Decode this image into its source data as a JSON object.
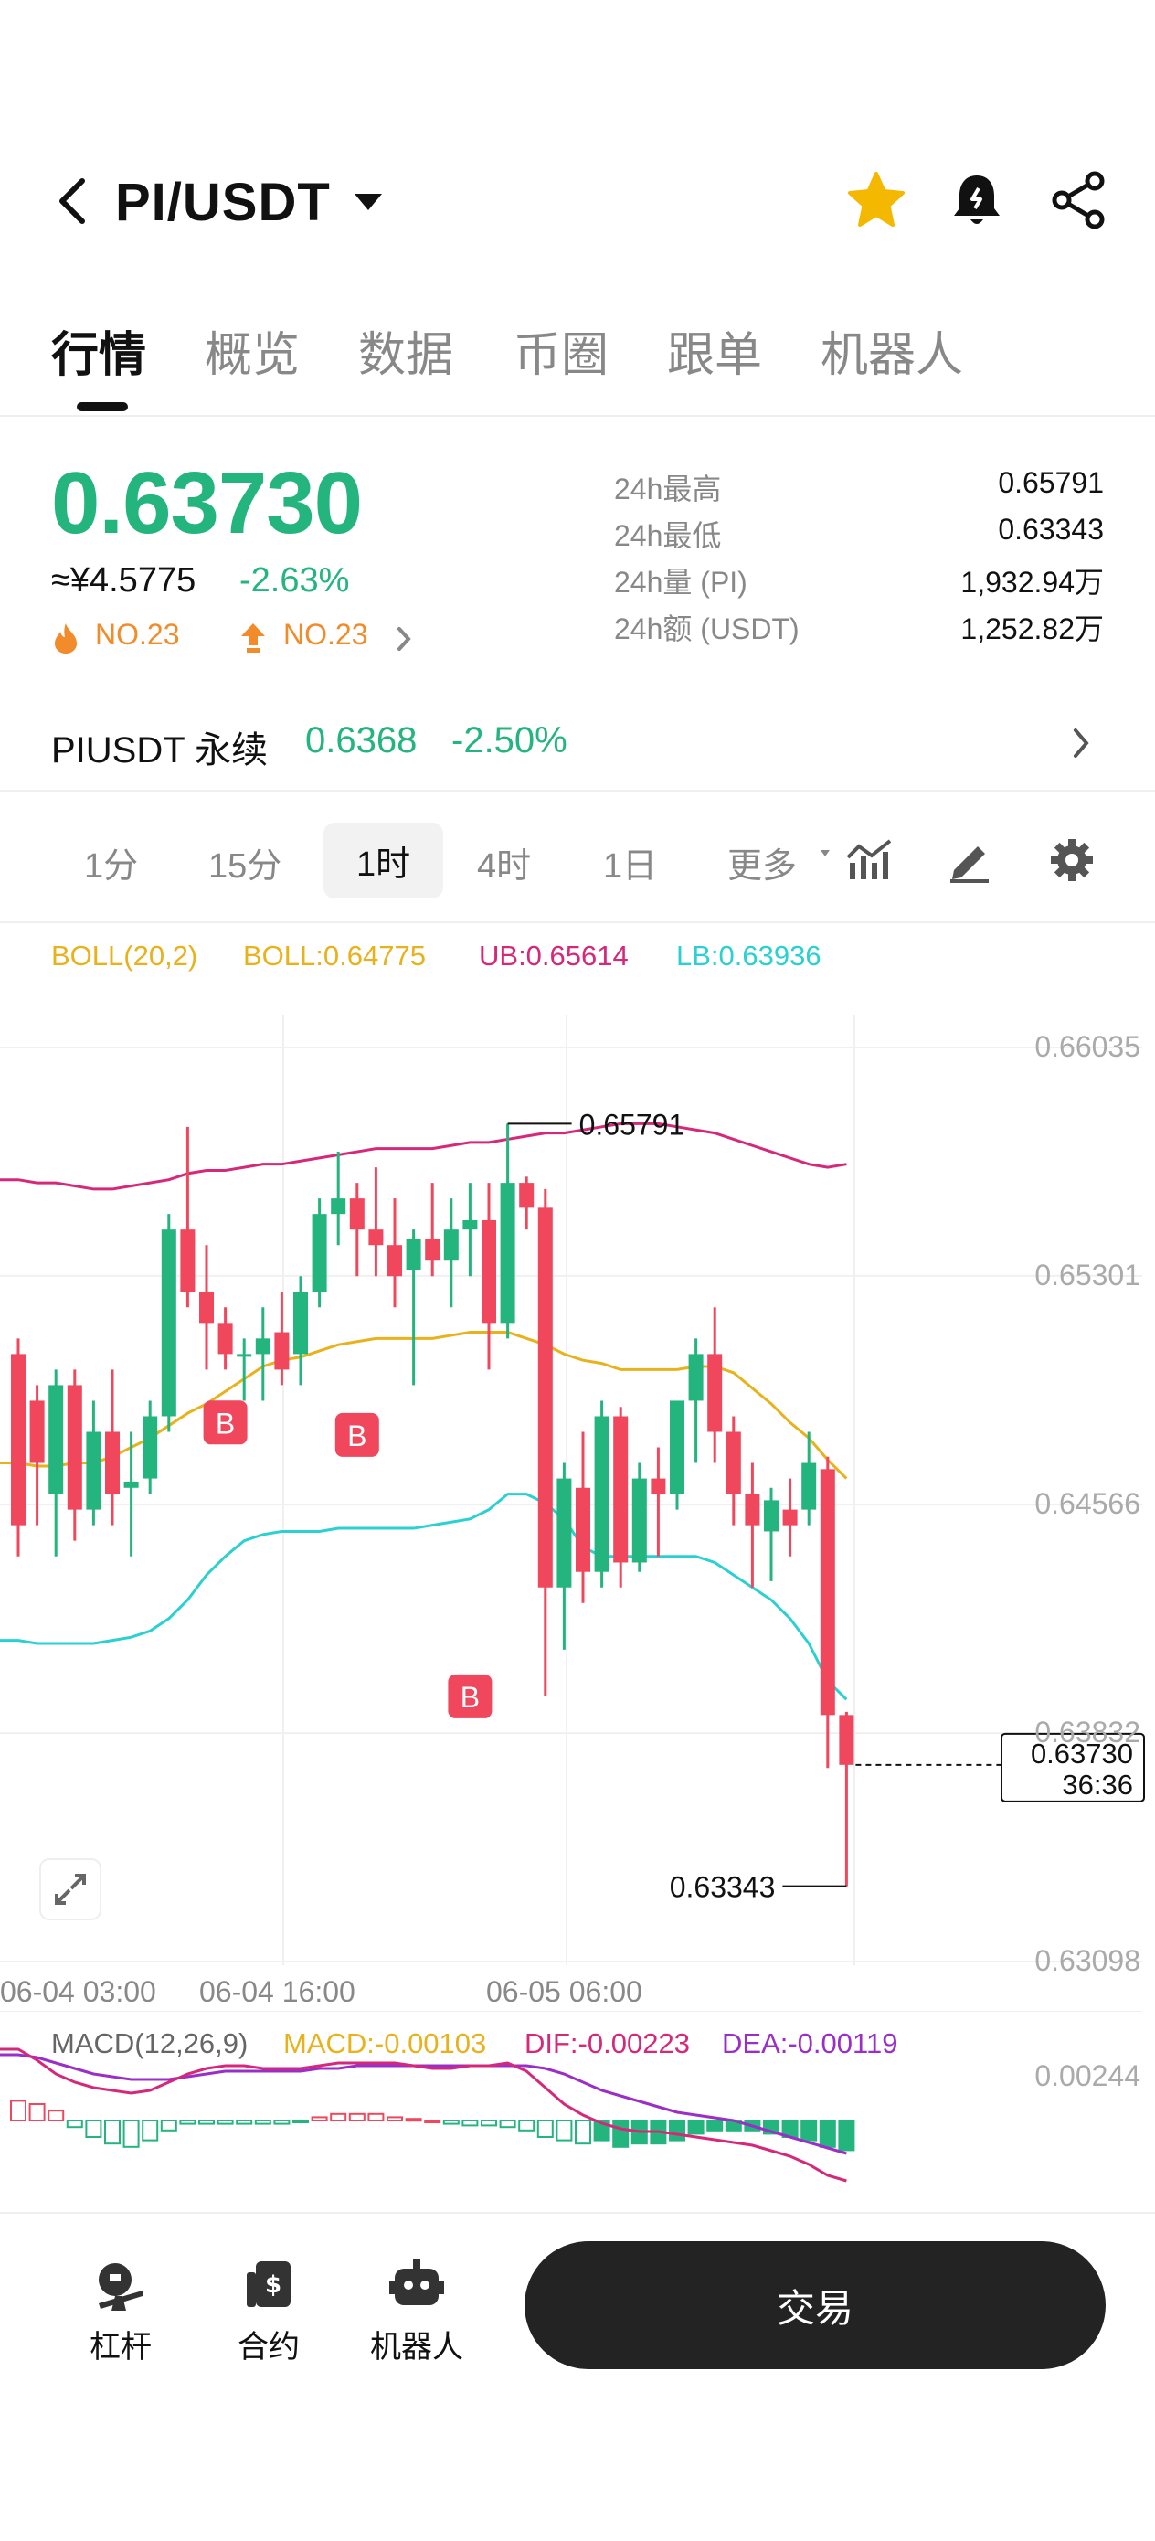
{
  "header": {
    "pair": "PI/USDT",
    "icons": [
      "back-icon",
      "chevron-down-icon",
      "star-icon",
      "bell-icon",
      "share-icon"
    ],
    "favorite_color": "#f5b800"
  },
  "tabs": [
    "行情",
    "概览",
    "数据",
    "币圈",
    "跟单",
    "机器人"
  ],
  "active_tab": "行情",
  "ticker": {
    "last_price": "0.63730",
    "cny_price": "≈¥4.5775",
    "change_pct": "-2.63%",
    "hot_rank": "NO.23",
    "gainer_rank": "NO.23",
    "stats": [
      {
        "label": "24h最高",
        "value": "0.65791"
      },
      {
        "label": "24h最低",
        "value": "0.63343"
      },
      {
        "label": "24h量 (PI)",
        "value": "1,932.94万"
      },
      {
        "label": "24h额 (USDT)",
        "value": "1,252.82万"
      }
    ]
  },
  "perp": {
    "name": "PIUSDT 永续",
    "price": "0.6368",
    "change": "-2.50%"
  },
  "intervals": [
    "1分",
    "15分",
    "1时",
    "4时",
    "1日",
    "更多"
  ],
  "active_interval": "1时",
  "indicators": {
    "boll_name": "BOLL(20,2)",
    "boll": "BOLL:0.64775",
    "ub": "UB:0.65614",
    "lb": "LB:0.63936",
    "macd_name": "MACD(12,26,9)",
    "macd": "MACD:-0.00103",
    "dif": "DIF:-0.00223",
    "dea": "DEA:-0.00119"
  },
  "colors": {
    "up": "#24b47e",
    "down": "#f0475c",
    "boll": "#e8b21c",
    "ub": "#d6287a",
    "lb": "#2bd0d0",
    "dif": "#d6287a",
    "dea": "#9a2fc8",
    "rank": "#f28b2a"
  },
  "chart_data": {
    "type": "candlestick",
    "price_axis_ticks": [
      "0.66035",
      "0.65301",
      "0.64566",
      "0.63832",
      "0.63098"
    ],
    "time_axis_ticks": [
      "06-04 03:00",
      "06-04 16:00",
      "06-05 06:00"
    ],
    "high_label": "0.65791",
    "low_label": "0.63343",
    "last_price_label": "0.63730",
    "countdown": "36:36",
    "buy_marker": "B",
    "macd_axis_ticks": [
      "0.00244"
    ],
    "candles": [
      {
        "o": 0.6505,
        "h": 0.651,
        "l": 0.644,
        "c": 0.645
      },
      {
        "o": 0.649,
        "h": 0.6495,
        "l": 0.645,
        "c": 0.647
      },
      {
        "o": 0.646,
        "h": 0.65,
        "l": 0.644,
        "c": 0.6495
      },
      {
        "o": 0.6495,
        "h": 0.65,
        "l": 0.6445,
        "c": 0.6455
      },
      {
        "o": 0.6455,
        "h": 0.649,
        "l": 0.645,
        "c": 0.648
      },
      {
        "o": 0.648,
        "h": 0.65,
        "l": 0.645,
        "c": 0.646
      },
      {
        "o": 0.6462,
        "h": 0.648,
        "l": 0.644,
        "c": 0.6464
      },
      {
        "o": 0.6465,
        "h": 0.649,
        "l": 0.646,
        "c": 0.6485
      },
      {
        "o": 0.6485,
        "h": 0.655,
        "l": 0.648,
        "c": 0.6545
      },
      {
        "o": 0.6545,
        "h": 0.6578,
        "l": 0.652,
        "c": 0.6525
      },
      {
        "o": 0.6525,
        "h": 0.654,
        "l": 0.65,
        "c": 0.6515
      },
      {
        "o": 0.6515,
        "h": 0.652,
        "l": 0.65,
        "c": 0.6505
      },
      {
        "o": 0.6505,
        "h": 0.651,
        "l": 0.649,
        "c": 0.6505
      },
      {
        "o": 0.6505,
        "h": 0.652,
        "l": 0.649,
        "c": 0.651
      },
      {
        "o": 0.6512,
        "h": 0.6525,
        "l": 0.6495,
        "c": 0.65
      },
      {
        "o": 0.6505,
        "h": 0.653,
        "l": 0.6495,
        "c": 0.6525
      },
      {
        "o": 0.6525,
        "h": 0.6555,
        "l": 0.652,
        "c": 0.655
      },
      {
        "o": 0.655,
        "h": 0.657,
        "l": 0.654,
        "c": 0.6555
      },
      {
        "o": 0.6555,
        "h": 0.656,
        "l": 0.653,
        "c": 0.6545
      },
      {
        "o": 0.6545,
        "h": 0.6565,
        "l": 0.653,
        "c": 0.654
      },
      {
        "o": 0.654,
        "h": 0.6555,
        "l": 0.652,
        "c": 0.653
      },
      {
        "o": 0.6532,
        "h": 0.6545,
        "l": 0.6495,
        "c": 0.6542
      },
      {
        "o": 0.6542,
        "h": 0.656,
        "l": 0.653,
        "c": 0.6535
      },
      {
        "o": 0.6535,
        "h": 0.6555,
        "l": 0.652,
        "c": 0.6545
      },
      {
        "o": 0.6545,
        "h": 0.656,
        "l": 0.653,
        "c": 0.6548
      },
      {
        "o": 0.6548,
        "h": 0.656,
        "l": 0.65,
        "c": 0.6515
      },
      {
        "o": 0.6515,
        "h": 0.6579,
        "l": 0.651,
        "c": 0.656
      },
      {
        "o": 0.656,
        "h": 0.6562,
        "l": 0.6545,
        "c": 0.6552
      },
      {
        "o": 0.6552,
        "h": 0.6558,
        "l": 0.6395,
        "c": 0.643
      },
      {
        "o": 0.643,
        "h": 0.647,
        "l": 0.641,
        "c": 0.6465
      },
      {
        "o": 0.6462,
        "h": 0.648,
        "l": 0.6425,
        "c": 0.6435
      },
      {
        "o": 0.6435,
        "h": 0.649,
        "l": 0.643,
        "c": 0.6485
      },
      {
        "o": 0.6485,
        "h": 0.6488,
        "l": 0.643,
        "c": 0.6438
      },
      {
        "o": 0.6438,
        "h": 0.647,
        "l": 0.6435,
        "c": 0.6465
      },
      {
        "o": 0.6465,
        "h": 0.6475,
        "l": 0.644,
        "c": 0.646
      },
      {
        "o": 0.646,
        "h": 0.649,
        "l": 0.6455,
        "c": 0.649
      },
      {
        "o": 0.649,
        "h": 0.651,
        "l": 0.647,
        "c": 0.6505
      },
      {
        "o": 0.6505,
        "h": 0.652,
        "l": 0.647,
        "c": 0.648
      },
      {
        "o": 0.648,
        "h": 0.6485,
        "l": 0.645,
        "c": 0.646
      },
      {
        "o": 0.646,
        "h": 0.647,
        "l": 0.643,
        "c": 0.645
      },
      {
        "o": 0.6448,
        "h": 0.6462,
        "l": 0.6432,
        "c": 0.6458
      },
      {
        "o": 0.6455,
        "h": 0.6465,
        "l": 0.644,
        "c": 0.645
      },
      {
        "o": 0.6455,
        "h": 0.648,
        "l": 0.645,
        "c": 0.647
      },
      {
        "o": 0.6468,
        "h": 0.6472,
        "l": 0.6372,
        "c": 0.6389
      },
      {
        "o": 0.6389,
        "h": 0.639,
        "l": 0.6334,
        "c": 0.6373
      }
    ],
    "boll_mid": [
      0.647,
      0.6469,
      0.6469,
      0.647,
      0.647,
      0.6472,
      0.6475,
      0.6478,
      0.6482,
      0.6486,
      0.6489,
      0.6493,
      0.6497,
      0.6501,
      0.6503,
      0.6504,
      0.6506,
      0.6508,
      0.6509,
      0.651,
      0.651,
      0.651,
      0.651,
      0.6511,
      0.6512,
      0.6512,
      0.6512,
      0.651,
      0.6508,
      0.6505,
      0.6503,
      0.6502,
      0.65,
      0.65,
      0.65,
      0.65,
      0.6501,
      0.6501,
      0.6499,
      0.6494,
      0.6489,
      0.6483,
      0.6478,
      0.6471,
      0.6465
    ],
    "boll_upper": [
      0.6561,
      0.656,
      0.656,
      0.6559,
      0.6558,
      0.6558,
      0.6559,
      0.656,
      0.6561,
      0.6563,
      0.6564,
      0.6564,
      0.6565,
      0.6566,
      0.6566,
      0.6567,
      0.6568,
      0.6569,
      0.657,
      0.6571,
      0.6571,
      0.6571,
      0.6571,
      0.6572,
      0.6573,
      0.6573,
      0.6574,
      0.6575,
      0.6576,
      0.6576,
      0.6577,
      0.6578,
      0.6579,
      0.6579,
      0.6579,
      0.6578,
      0.6577,
      0.6576,
      0.6574,
      0.6572,
      0.657,
      0.6568,
      0.6566,
      0.6565,
      0.6566
    ],
    "boll_lower": [
      0.6413,
      0.6412,
      0.6412,
      0.6412,
      0.6412,
      0.6413,
      0.6414,
      0.6416,
      0.642,
      0.6426,
      0.6434,
      0.644,
      0.6445,
      0.6447,
      0.6448,
      0.6448,
      0.6448,
      0.6449,
      0.6449,
      0.6449,
      0.6449,
      0.6449,
      0.645,
      0.6451,
      0.6452,
      0.6455,
      0.646,
      0.646,
      0.6457,
      0.6452,
      0.6443,
      0.644,
      0.644,
      0.644,
      0.644,
      0.644,
      0.644,
      0.6438,
      0.6434,
      0.643,
      0.6426,
      0.642,
      0.6412,
      0.64,
      0.6394
    ],
    "buy_markers": [
      {
        "index": 11,
        "price": 0.6483
      },
      {
        "index": 18,
        "price": 0.6479
      },
      {
        "index": 24,
        "price": 0.6395
      }
    ],
    "macd_hist": [
      0.00012,
      0.0001,
      6e-05,
      -4e-05,
      -0.0001,
      -0.00014,
      -0.00016,
      -0.00012,
      -6e-05,
      -2e-05,
      -2e-05,
      -2e-05,
      -2e-05,
      -2e-05,
      -2e-05,
      -1e-05,
      2e-05,
      4e-05,
      4e-05,
      4e-05,
      2e-05,
      1e-05,
      0.0,
      -2e-05,
      -3e-05,
      -3e-05,
      -4e-05,
      -6e-05,
      -0.0001,
      -0.00012,
      -0.00014,
      -0.00012,
      -0.00016,
      -0.00014,
      -0.00014,
      -0.00012,
      -8e-05,
      -6e-05,
      -6e-05,
      -6e-05,
      -8e-05,
      -0.0001,
      -0.00012,
      -0.00016,
      -0.00018
    ],
    "macd_dif": [
      0.0026,
      0.0022,
      0.0017,
      0.0014,
      0.0012,
      0.0011,
      0.001,
      0.0011,
      0.0014,
      0.0017,
      0.0019,
      0.002,
      0.002,
      0.0019,
      0.0019,
      0.0019,
      0.002,
      0.0021,
      0.0021,
      0.0021,
      0.0021,
      0.002,
      0.0019,
      0.0019,
      0.002,
      0.002,
      0.0021,
      0.0018,
      0.0012,
      0.0006,
      0.0002,
      -0.0001,
      -0.0003,
      -0.0004,
      -0.0004,
      -0.0005,
      -0.0006,
      -0.0007,
      -0.0008,
      -0.0009,
      -0.0011,
      -0.0013,
      -0.0016,
      -0.002,
      -0.0022
    ],
    "macd_dea": [
      0.0024,
      0.0023,
      0.0021,
      0.0019,
      0.0017,
      0.0016,
      0.0015,
      0.0015,
      0.0015,
      0.0016,
      0.0017,
      0.0018,
      0.0018,
      0.0018,
      0.0018,
      0.0018,
      0.0019,
      0.0019,
      0.002,
      0.002,
      0.002,
      0.002,
      0.002,
      0.002,
      0.002,
      0.002,
      0.002,
      0.002,
      0.0019,
      0.0017,
      0.0014,
      0.0011,
      0.0009,
      0.0007,
      0.0005,
      0.0003,
      0.0002,
      0.0001,
      0.0,
      -0.0002,
      -0.0004,
      -0.0006,
      -0.0008,
      -0.001,
      -0.0012
    ]
  },
  "bottom_nav": {
    "items": [
      {
        "label": "杠杆",
        "icon": "leverage-icon"
      },
      {
        "label": "合约",
        "icon": "contract-icon"
      },
      {
        "label": "机器人",
        "icon": "robot-icon"
      }
    ],
    "trade_label": "交易"
  }
}
